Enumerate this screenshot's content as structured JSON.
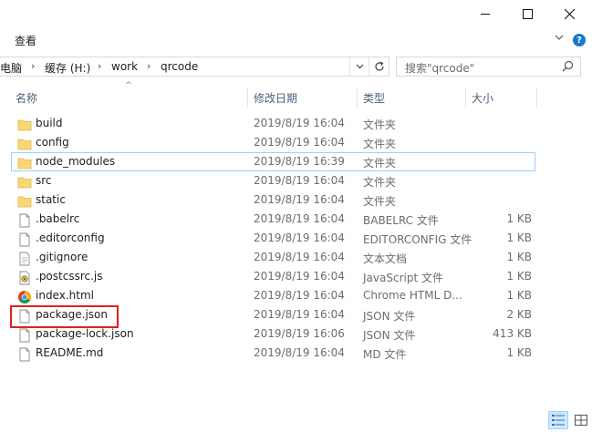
{
  "window": {
    "minimize_icon": "minimize-icon",
    "maximize_icon": "maximize-icon",
    "close_icon": "close-icon"
  },
  "ribbon": {
    "view_tab": "查看",
    "help_icon_label": "?"
  },
  "address": {
    "crumbs": [
      "电脑",
      "缓存 (H:)",
      "work",
      "qrcode"
    ]
  },
  "search": {
    "placeholder": "搜索\"qrcode\""
  },
  "columns": {
    "name": "名称",
    "date": "修改日期",
    "type": "类型",
    "size": "大小"
  },
  "files": [
    {
      "name": "build",
      "date": "2019/8/19 16:04",
      "type": "文件夹",
      "size": "",
      "icon": "folder"
    },
    {
      "name": "config",
      "date": "2019/8/19 16:04",
      "type": "文件夹",
      "size": "",
      "icon": "folder"
    },
    {
      "name": "node_modules",
      "date": "2019/8/19 16:39",
      "type": "文件夹",
      "size": "",
      "icon": "folder"
    },
    {
      "name": "src",
      "date": "2019/8/19 16:04",
      "type": "文件夹",
      "size": "",
      "icon": "folder"
    },
    {
      "name": "static",
      "date": "2019/8/19 16:04",
      "type": "文件夹",
      "size": "",
      "icon": "folder"
    },
    {
      "name": ".babelrc",
      "date": "2019/8/19 16:04",
      "type": "BABELRC 文件",
      "size": "1 KB",
      "icon": "file"
    },
    {
      "name": ".editorconfig",
      "date": "2019/8/19 16:04",
      "type": "EDITORCONFIG 文件",
      "size": "1 KB",
      "icon": "file"
    },
    {
      "name": ".gitignore",
      "date": "2019/8/19 16:04",
      "type": "文本文档",
      "size": "1 KB",
      "icon": "file"
    },
    {
      "name": ".postcssrc.js",
      "date": "2019/8/19 16:04",
      "type": "JavaScript 文件",
      "size": "1 KB",
      "icon": "script"
    },
    {
      "name": "index.html",
      "date": "2019/8/19 16:04",
      "type": "Chrome HTML D...",
      "size": "1 KB",
      "icon": "chrome"
    },
    {
      "name": "package.json",
      "date": "2019/8/19 16:04",
      "type": "JSON 文件",
      "size": "2 KB",
      "icon": "file"
    },
    {
      "name": "package-lock.json",
      "date": "2019/8/19 16:06",
      "type": "JSON 文件",
      "size": "413 KB",
      "icon": "file"
    },
    {
      "name": "README.md",
      "date": "2019/8/19 16:04",
      "type": "MD 文件",
      "size": "1 KB",
      "icon": "file"
    }
  ],
  "colors": {
    "folder": "#f8d775",
    "selection_border": "#99d1ff",
    "annotation_box": "#e02020"
  }
}
